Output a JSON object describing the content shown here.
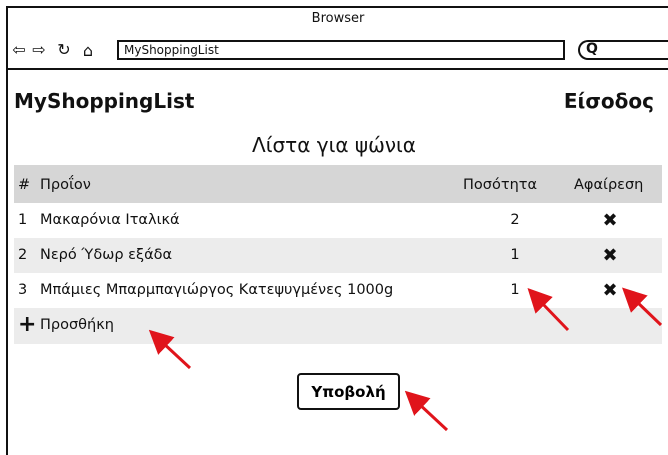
{
  "browser": {
    "title": "Browser",
    "url": "MyShoppingList"
  },
  "header": {
    "brand": "MyShoppingList",
    "login": "Είσοδος"
  },
  "page": {
    "title": "Λίστα για ψώνια"
  },
  "table": {
    "columns": {
      "num": "#",
      "product": "Προΐον",
      "quantity": "Ποσότητα",
      "remove": "Αφαίρεση"
    },
    "rows": [
      {
        "num": "1",
        "product": "Μακαρόνια Ιταλικά",
        "quantity": "2",
        "remove_icon": "close-icon"
      },
      {
        "num": "2",
        "product": "Νερό Ύδωρ εξάδα",
        "quantity": "1",
        "remove_icon": "close-icon"
      },
      {
        "num": "3",
        "product": "Μπάμιες Μπαρμπαγιώργος Κατεψυγμένες 1000g",
        "quantity": "1",
        "remove_icon": "close-icon"
      }
    ],
    "add_label": "Προσθήκη"
  },
  "actions": {
    "submit_label": "Υποβολή"
  },
  "colors": {
    "header_row": "#d6d6d6",
    "alt_row": "#ececec",
    "annotation_arrow": "#e0141b"
  }
}
